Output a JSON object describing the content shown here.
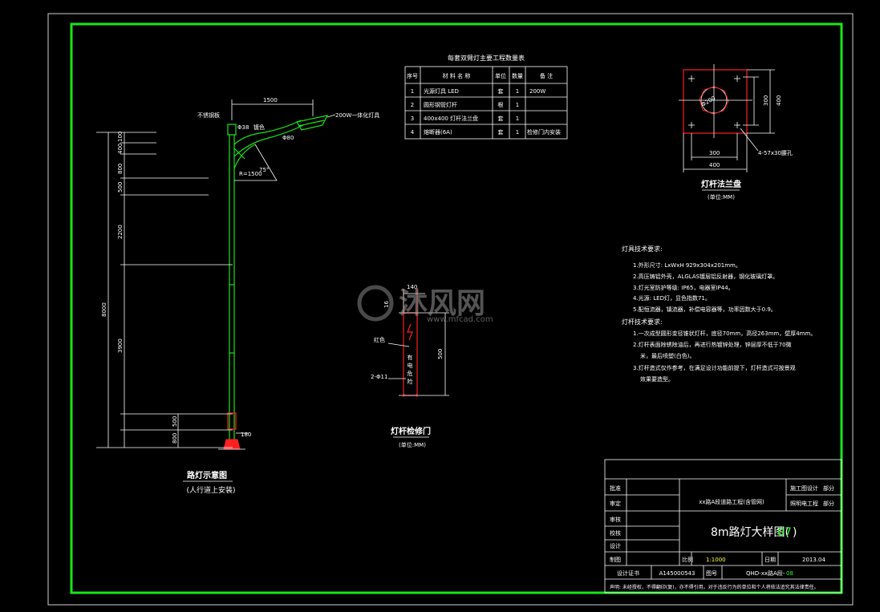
{
  "quantity_table": {
    "title": "每套双臂灯主要工程数量表",
    "headers": [
      "序号",
      "材 料 名 称",
      "单位",
      "数量",
      "备 注"
    ],
    "rows": [
      [
        "1",
        "光源灯具  LED",
        "套",
        "1",
        "200W"
      ],
      [
        "2",
        "圆形钢管灯杆",
        "根",
        "1",
        ""
      ],
      [
        "3",
        "400x400  灯杆法兰盘",
        "套",
        "1",
        ""
      ],
      [
        "4",
        "熔断器(6A)",
        "套",
        "1",
        "检修门内安装"
      ]
    ]
  },
  "streetlight_elevation": {
    "dim_arm": "1500",
    "label_stainless": "不锈钢板",
    "label_dia_top": "Φ38",
    "label_bend": "镀色",
    "label_dia_lamp": "Φ80",
    "label_lamp": "200W一体化灯具",
    "label_radius": "R=1500",
    "label_angle": "75°",
    "dims": [
      "100",
      "400",
      "800",
      "500",
      "2200",
      "3900",
      "500",
      "800"
    ],
    "dim_total": "8000",
    "dim_base": "180",
    "caption": "路灯示意图",
    "caption_note": "(人行道上安装)"
  },
  "flange": {
    "dim_dia": "Φ200",
    "dim_inner_v": "300",
    "dim_outer_v": "400",
    "dim_inner_h": "300",
    "dim_outer_h": "400",
    "hole_note": "4-57x30腰孔",
    "caption": "灯杆法兰盘",
    "caption_note": "(单位:MM)"
  },
  "door": {
    "dim_width": "140",
    "dim_top": "16",
    "dim_height": "500",
    "label_color": "红色",
    "label_holes": "2-Φ11",
    "door_text": "有电危险",
    "caption": "灯杆检修门",
    "caption_note": "(单位:MM)"
  },
  "watermark": {
    "brand": "沐风网",
    "url": "www.mfcad.com"
  },
  "notes": {
    "lamp_heading": "灯具技术要求:",
    "lamp_items": [
      "1.外形尺寸: LxWxH 929x304x201mm。",
      "2.高压铸铝外壳，ALGLAS镀层铝反射器，钢化玻璃灯罩。",
      "3.灯光室防护等级: IP65，电器室IP44。",
      "4.光源: LED灯，显色指数71。",
      "5.配恒流器，镇流器，补偿电容器等，功率因数大于0.9。"
    ],
    "pole_heading": "灯杆技术要求:",
    "pole_items": [
      "1.一次成型圆形变径锥状灯杆，底径70mm，高径263mm，壁厚4mm。",
      "2.灯杆表面除锈除油后，再进行热镀锌处理，锌层厚不低于70微",
      "米，最后喷塑(白色)。",
      "3.灯杆造式仅作参考，在满足设计功能前提下，灯杆造式可按景观",
      "效果要造型。"
    ]
  },
  "title_block": {
    "left_labels": [
      "批准",
      "审定",
      "审核",
      "校核",
      "设计",
      "制图"
    ],
    "project": "xx路A段道路工程(含管网)",
    "stage1_label": "施工图设计",
    "stage1_value": "部分",
    "stage2_label": "照明电工程",
    "stage2_value": "部分",
    "drawing_title": "8m路灯大样图(",
    "drawing_no_highlight": "07",
    "drawing_title_end": ")",
    "scale_label": "比例",
    "scale_value": "1:1000",
    "date_label": "日期",
    "date_value": "2013.04",
    "cert_label": "设计证书",
    "cert_value": "A145000543",
    "figno_label": "图号",
    "figno_value": "QHD-xx路A段-",
    "figno_highlight": "08",
    "statement": "声明: 未经授权，不得翻印(复)，亦不得引用。对于违反行为的单位和个人将依法追究其法律责任。"
  },
  "colors": {
    "background": "#000000",
    "frame": "#19e619",
    "line": "#ffffff",
    "accent_red": "#ff2020",
    "accent_yellow": "#ffff40"
  }
}
